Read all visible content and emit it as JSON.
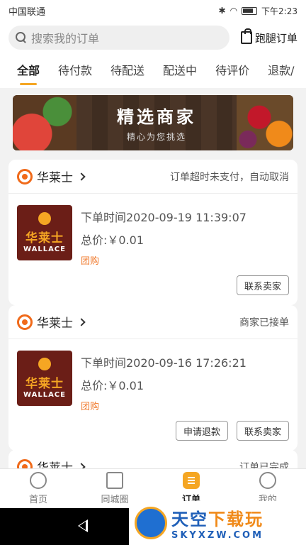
{
  "status_bar": {
    "carrier": "中国联通",
    "time": "下午2:23"
  },
  "search": {
    "placeholder": "搜索我的订单",
    "errand_label": "跑腿订单"
  },
  "tabs": [
    "全部",
    "待付款",
    "待配送",
    "配送中",
    "待评价",
    "退款/"
  ],
  "banner": {
    "title": "精选商家",
    "subtitle": "精心为您挑选"
  },
  "orders": [
    {
      "shop": "华莱士",
      "status": "订单超时未支付，自动取消",
      "logo_cn": "华莱士",
      "logo_en": "WALLACE",
      "time": "下单时间2020-09-19 11:39:07",
      "total": "总价:￥0.01",
      "tag": "团购",
      "actions": [
        "联系卖家"
      ]
    },
    {
      "shop": "华莱士",
      "status": "商家已接单",
      "logo_cn": "华莱士",
      "logo_en": "WALLACE",
      "time": "下单时间2020-09-16 17:26:21",
      "total": "总价:￥0.01",
      "tag": "团购",
      "actions": [
        "申请退款",
        "联系卖家"
      ]
    },
    {
      "shop": "华莱士",
      "status": "订单已完成"
    }
  ],
  "bottom_nav": [
    "首页",
    "同城圈",
    "订单",
    "我的"
  ],
  "watermark": {
    "cn_main": "天空",
    "cn_accent": "下载玩",
    "en": "SKYXZW.COM"
  },
  "colors": {
    "accent": "#f5a623",
    "tag": "#f0782a",
    "brand_dark": "#6b1e17"
  }
}
